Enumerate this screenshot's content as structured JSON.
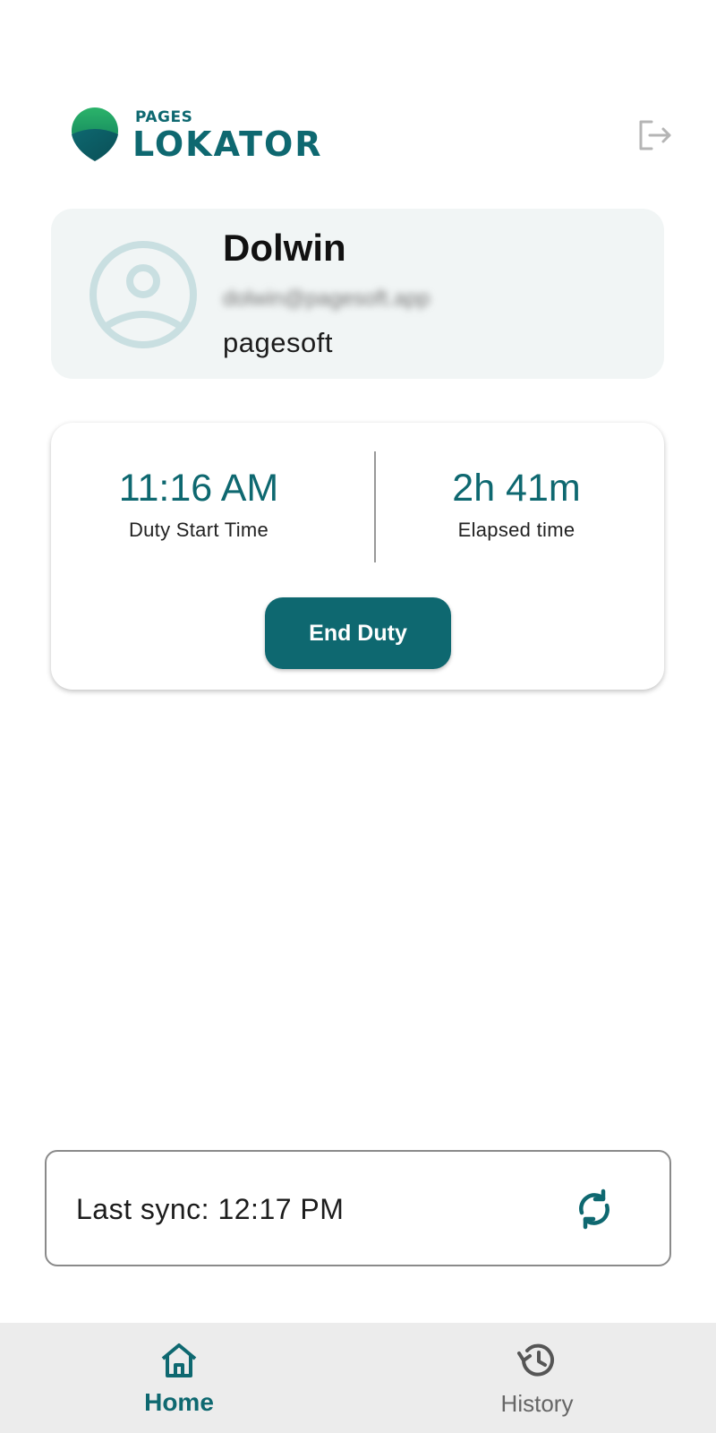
{
  "app": {
    "logo_small": "PAGES",
    "logo_big": "LOKATOR",
    "accent_color": "#0e6870"
  },
  "header": {
    "logout_icon": "logout-icon"
  },
  "profile": {
    "name": "Dolwin",
    "email": "dolwin@pagesoft.app",
    "organization": "pagesoft",
    "avatar_icon": "account-circle-icon"
  },
  "duty": {
    "start_time": "11:16 AM",
    "start_time_label": "Duty Start Time",
    "elapsed": "2h 41m",
    "elapsed_label": "Elapsed time",
    "end_button_label": "End Duty"
  },
  "sync": {
    "label": "Last sync: 12:17 PM",
    "icon": "sync-icon"
  },
  "nav": {
    "items": [
      {
        "label": "Home",
        "icon": "home-icon",
        "active": true
      },
      {
        "label": "History",
        "icon": "history-icon",
        "active": false
      }
    ]
  }
}
